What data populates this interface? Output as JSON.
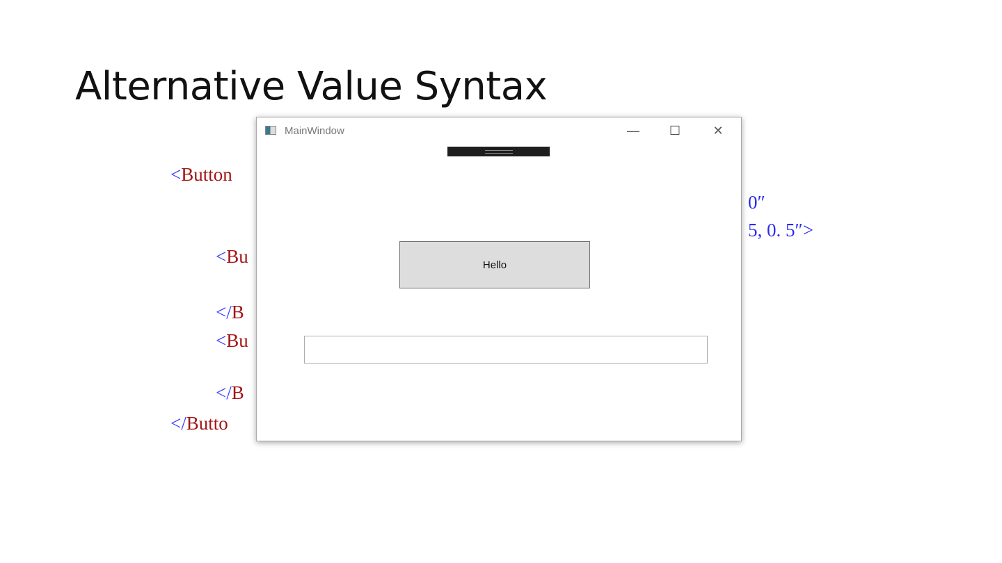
{
  "slide_title": "Alternative Value Syntax",
  "code_lines": {
    "l1": {
      "bracket": "<",
      "text": "Button"
    },
    "l2": {
      "bracket": "<",
      "text": "Bu"
    },
    "l3": {
      "bracket": "</",
      "text": "B"
    },
    "l4": {
      "bracket": "<",
      "text": "Bu"
    },
    "l5": {
      "bracket": "</",
      "text": "B"
    },
    "l6": {
      "bracket": "</",
      "text": "Butto"
    },
    "r1": "0″",
    "r2": "5, 0. 5″>"
  },
  "window": {
    "title": "MainWindow",
    "minimize": "—",
    "maximize": "☐",
    "close": "✕",
    "button_label": "Hello",
    "textbox_value": ""
  }
}
